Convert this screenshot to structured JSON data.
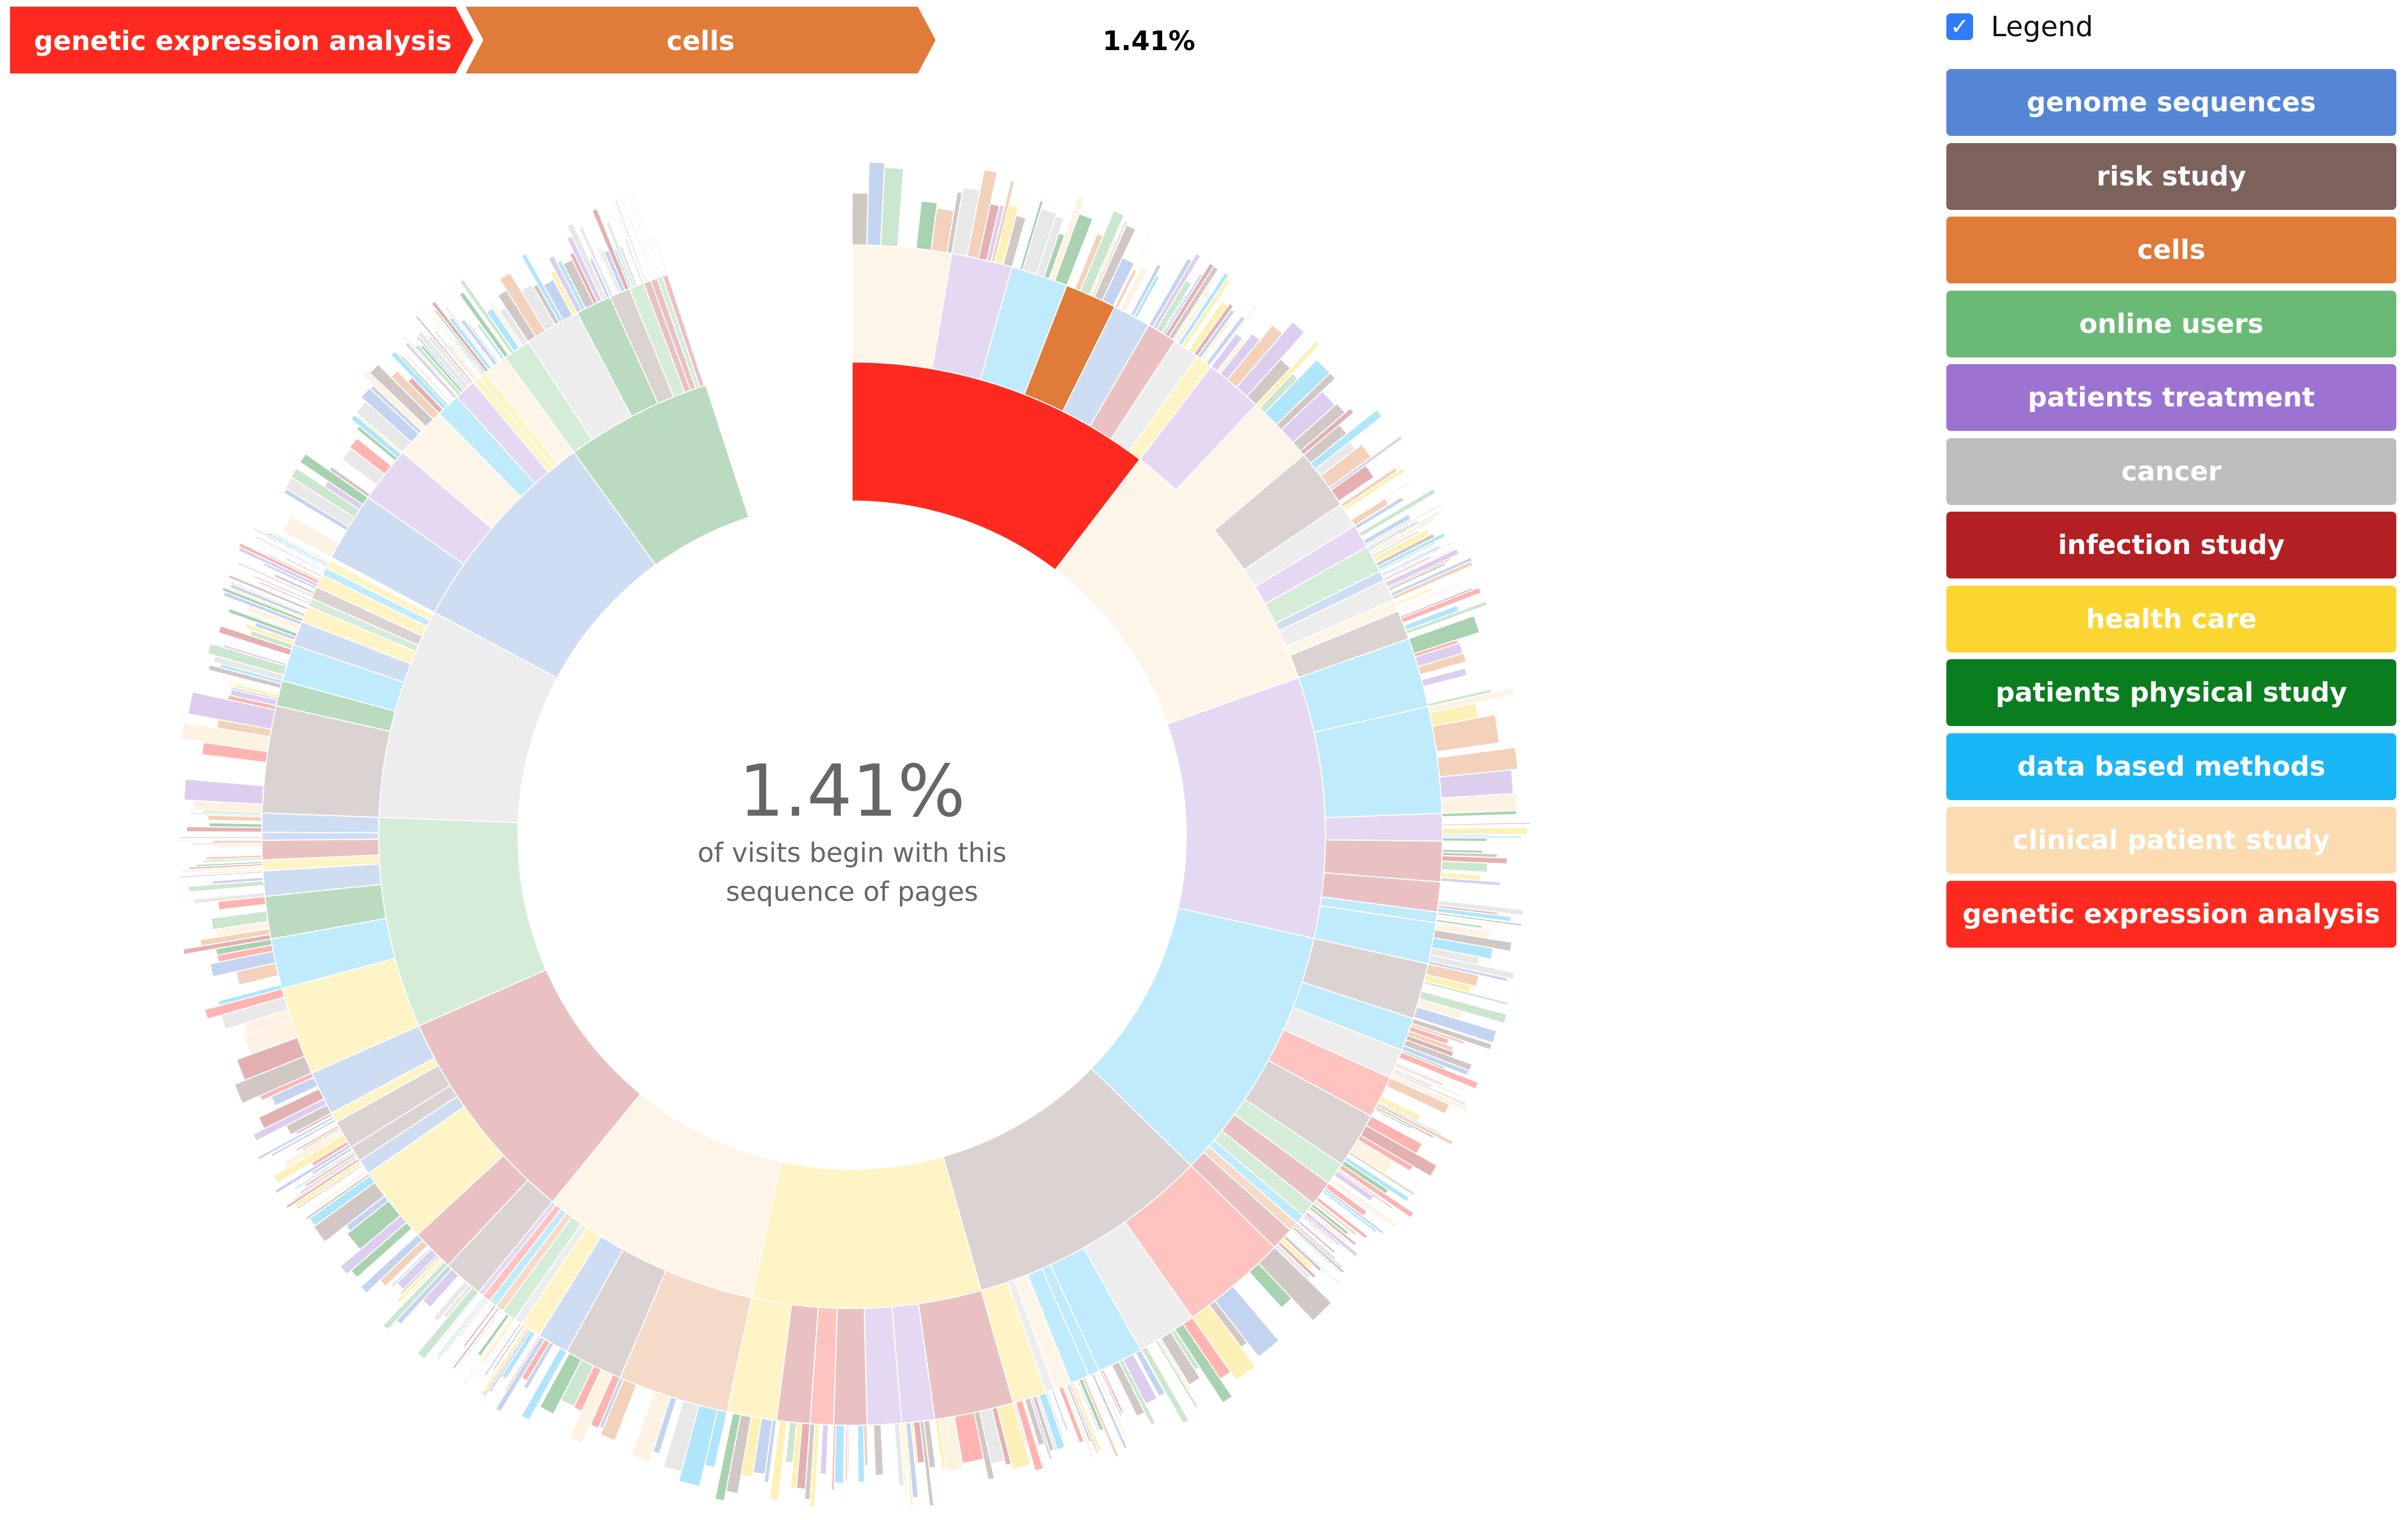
{
  "breadcrumb": {
    "steps": [
      {
        "label": "genetic expression analysis",
        "color": "#ff2a1f"
      },
      {
        "label": "cells",
        "color": "#e07b39"
      }
    ],
    "percentage": "1.41%"
  },
  "center": {
    "percentage": "1.41%",
    "line1": "of visits begin with this",
    "line2": "sequence of pages"
  },
  "legend_toggle": {
    "label": "Legend",
    "checked": true
  },
  "legend": [
    {
      "label": "genome sequences",
      "color": "#5585d5"
    },
    {
      "label": "risk study",
      "color": "#7c625b"
    },
    {
      "label": "cells",
      "color": "#e07b39"
    },
    {
      "label": "online users",
      "color": "#6aba76"
    },
    {
      "label": "patients treatment",
      "color": "#9d73d2"
    },
    {
      "label": "cancer",
      "color": "#bdbdbd"
    },
    {
      "label": "infection study",
      "color": "#b32024"
    },
    {
      "label": "health care",
      "color": "#fcd630"
    },
    {
      "label": "patients physical study",
      "color": "#0a7d1e"
    },
    {
      "label": "data based methods",
      "color": "#1ab7f6"
    },
    {
      "label": "clinical patient study",
      "color": "#fcdbb0"
    },
    {
      "label": "genetic expression analysis",
      "color": "#ff2a1f"
    }
  ],
  "chart_data": {
    "type": "sunburst",
    "title": "",
    "highlighted_path": [
      "genetic expression analysis",
      "cells"
    ],
    "highlighted_share": "1.41%",
    "ring1": [
      {
        "name": "genetic expression analysis",
        "share": 0.104
      },
      {
        "name": "clinical patient study",
        "share": 0.092
      },
      {
        "name": "patients treatment",
        "share": 0.089
      },
      {
        "name": "data based methods",
        "share": 0.088
      },
      {
        "name": "risk study",
        "share": 0.083
      },
      {
        "name": "health care",
        "share": 0.078
      },
      {
        "name": "clinical patient study",
        "share": 0.075
      },
      {
        "name": "infection study",
        "share": 0.075
      },
      {
        "name": "online users",
        "share": 0.072
      },
      {
        "name": "cancer",
        "share": 0.072
      },
      {
        "name": "genome sequences",
        "share": 0.072
      },
      {
        "name": "patients physical study",
        "share": 0.05
      }
    ],
    "ring2_parent0": [
      {
        "name": "clinical patient study",
        "share": 0.26
      },
      {
        "name": "patients treatment",
        "share": 0.16
      },
      {
        "name": "data based methods",
        "share": 0.15
      },
      {
        "name": "cells",
        "share": 0.136
      },
      {
        "name": "genome sequences",
        "share": 0.1
      },
      {
        "name": "infection study",
        "share": 0.08
      },
      {
        "name": "cancer",
        "share": 0.07
      },
      {
        "name": "health care",
        "share": 0.044
      }
    ]
  }
}
